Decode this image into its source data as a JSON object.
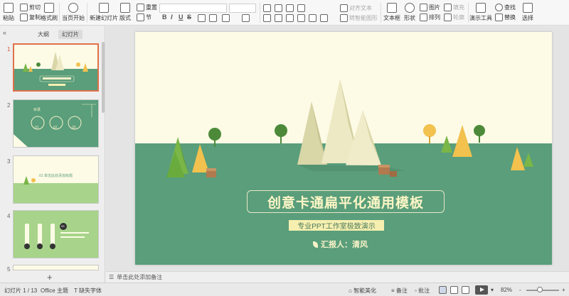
{
  "ribbon": {
    "paste": "粘贴",
    "cut": "剪切",
    "copy": "复制",
    "format_painter": "格式刷",
    "from_current": "当页开始",
    "new_slide": "新建幻灯片",
    "layout": "版式",
    "section": "节",
    "reset": "重置",
    "font_value": "",
    "size_value": "",
    "bold": "B",
    "italic": "I",
    "underline": "U",
    "strike": "S",
    "text_direction": "对齐文本",
    "smartart": "转智能图形",
    "textbox": "文本框",
    "shape": "形状",
    "arrange": "排列",
    "picture": "图片",
    "fill": "填充",
    "outline": "轮廓",
    "presentation_tools": "演示工具",
    "find": "查找",
    "replace": "替换",
    "select": "选择"
  },
  "panel": {
    "collapse": "«",
    "tab_outline": "大纲",
    "tab_slides": "幻灯片",
    "slide_numbers": [
      "1",
      "2",
      "3",
      "4",
      "5"
    ],
    "thumb2_text": [
      "目录",
      "01",
      "02",
      "03"
    ],
    "thumb3_text": "01 单击此处添加标题",
    "thumb4_text": "03",
    "add": "+"
  },
  "slide": {
    "title": "创意卡通扁平化通用模板",
    "subtitle": "专业PPT工作室极致演示",
    "reporter": "汇报人：清风"
  },
  "notes": {
    "placeholder": "单击此处添加备注"
  },
  "status": {
    "slide_count": "幻灯片 1 / 13",
    "theme": "Office 主题",
    "missing_font": "缺失字体",
    "beautify": "智能美化",
    "notes": "备注",
    "comments": "批注",
    "zoom": "82%",
    "zoom_minus": "-",
    "zoom_plus": "+"
  },
  "colors": {
    "slide_bg": "#fdfbe6",
    "ground": "#5a9e7b",
    "accent_orange": "#e0714a"
  }
}
